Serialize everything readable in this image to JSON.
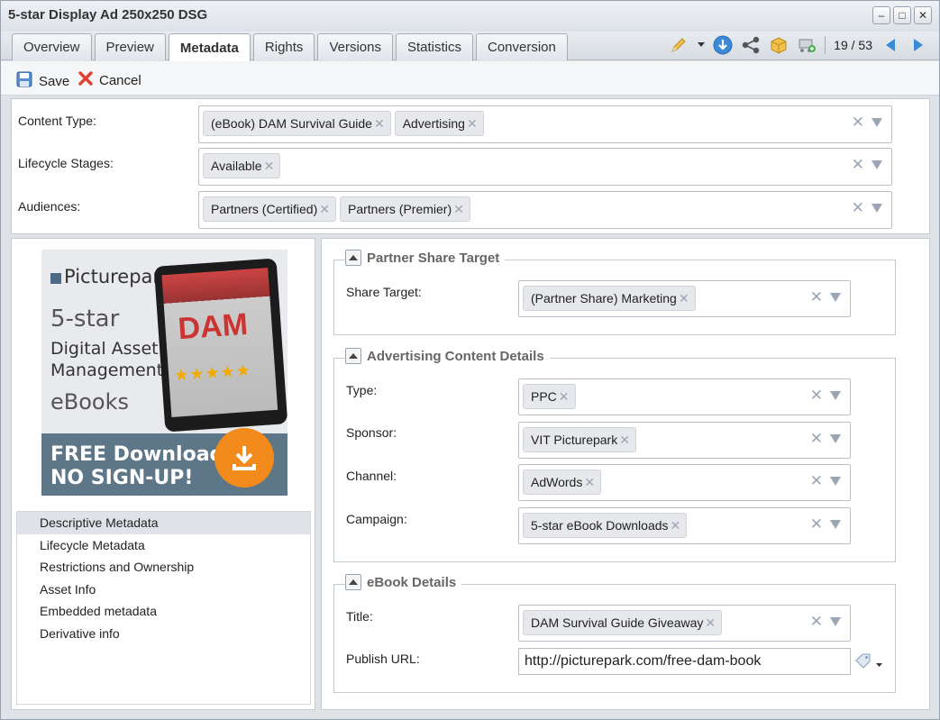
{
  "window": {
    "title": "5-star Display Ad 250x250 DSG"
  },
  "tabs": [
    {
      "label": "Overview"
    },
    {
      "label": "Preview"
    },
    {
      "label": "Metadata"
    },
    {
      "label": "Rights"
    },
    {
      "label": "Versions"
    },
    {
      "label": "Statistics"
    },
    {
      "label": "Conversion"
    }
  ],
  "pager": {
    "text": "19 / 53"
  },
  "actions": {
    "save": "Save",
    "cancel": "Cancel"
  },
  "classification": {
    "content_type": {
      "label": "Content Type:",
      "tags": [
        "(eBook) DAM Survival Guide",
        "Advertising"
      ]
    },
    "lifecycle": {
      "label": "Lifecycle Stages:",
      "tags": [
        "Available"
      ]
    },
    "audiences": {
      "label": "Audiences:",
      "tags": [
        "Partners (Certified)",
        "Partners (Premier)"
      ]
    }
  },
  "ad_preview": {
    "brand": "Picturepark",
    "line1": "5-star",
    "line2a": "Digital Asset",
    "line2b": "Management",
    "line3": "eBooks",
    "free1": "FREE Download",
    "free2": "NO SIGN-UP!",
    "book": "DAM",
    "stars": "★★★★★"
  },
  "nav": [
    "Descriptive Metadata",
    "Lifecycle Metadata",
    "Restrictions and Ownership",
    "Asset Info",
    "Embedded metadata",
    "Derivative info"
  ],
  "sections": {
    "partner": {
      "title": "Partner Share Target",
      "share_target": {
        "label": "Share Target:",
        "tags": [
          "(Partner Share) Marketing"
        ]
      }
    },
    "advertising": {
      "title": "Advertising Content Details",
      "type": {
        "label": "Type:",
        "tags": [
          "PPC"
        ]
      },
      "sponsor": {
        "label": "Sponsor:",
        "tags": [
          "VIT Picturepark"
        ]
      },
      "channel": {
        "label": "Channel:",
        "tags": [
          "AdWords"
        ]
      },
      "campaign": {
        "label": "Campaign:",
        "tags": [
          "5-star eBook Downloads"
        ]
      }
    },
    "ebook": {
      "title": "eBook Details",
      "title_field": {
        "label": "Title:",
        "tags": [
          "DAM Survival Guide Giveaway"
        ]
      },
      "publish_url": {
        "label": "Publish URL:",
        "value": "http://picturepark.com/free-dam-book"
      }
    }
  }
}
